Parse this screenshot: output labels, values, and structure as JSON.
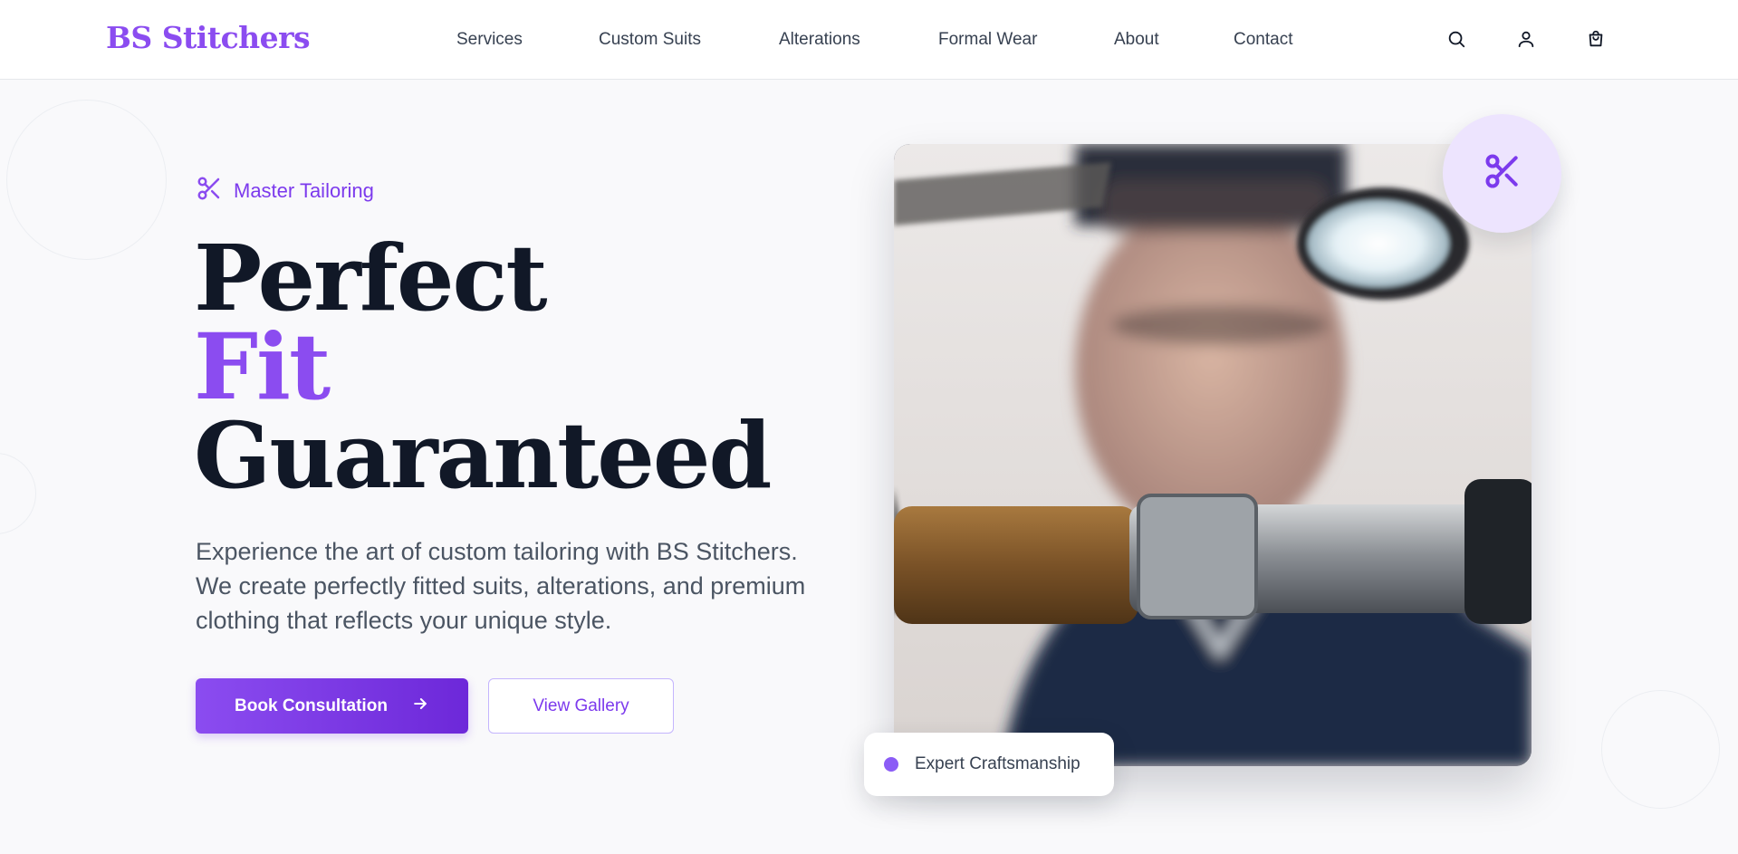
{
  "brand": {
    "name": "BS Stitchers",
    "accent_color": "#8b4cf0"
  },
  "nav": {
    "items": [
      {
        "label": "Services"
      },
      {
        "label": "Custom Suits"
      },
      {
        "label": "Alterations"
      },
      {
        "label": "Formal Wear"
      },
      {
        "label": "About"
      },
      {
        "label": "Contact"
      }
    ],
    "icons": [
      "search-icon",
      "user-icon",
      "shopping-bag-icon"
    ]
  },
  "hero": {
    "tagline": "Master Tailoring",
    "tagline_icon": "scissors-icon",
    "headline": {
      "line1": "Perfect",
      "line2": "Fit",
      "line3": "Guaranteed"
    },
    "description": "Experience the art of custom tailoring with BS Stitchers. We create perfectly fitted suits, alterations, and premium clothing that reflects your unique style.",
    "primary_button": {
      "label": "Book Consultation",
      "icon": "arrow-right-icon"
    },
    "secondary_button": {
      "label": "View Gallery"
    },
    "image_badge": {
      "label": "Expert Craftsmanship",
      "dot_color": "#8b5cf6"
    },
    "floating_icon": "scissors-icon"
  },
  "colors": {
    "primary": "#7c3aed",
    "heading": "#111827",
    "body_text": "#4b5563",
    "background": "#f9f9fb"
  }
}
